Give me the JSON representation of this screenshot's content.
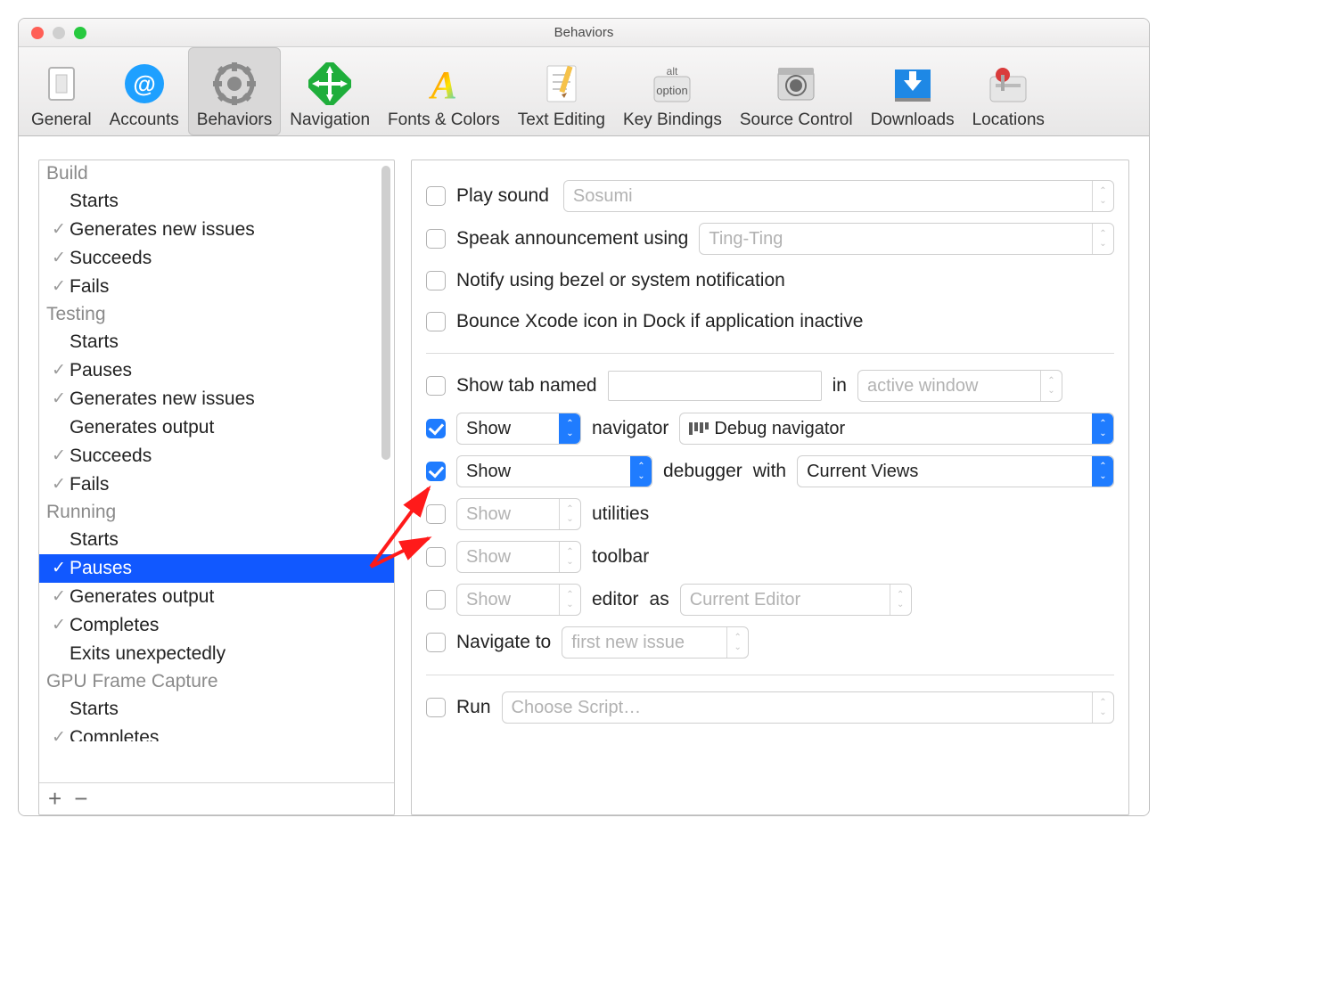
{
  "title": "Behaviors",
  "toolbar": [
    {
      "label": "General",
      "sel": false
    },
    {
      "label": "Accounts",
      "sel": false
    },
    {
      "label": "Behaviors",
      "sel": true
    },
    {
      "label": "Navigation",
      "sel": false
    },
    {
      "label": "Fonts & Colors",
      "sel": false
    },
    {
      "label": "Text Editing",
      "sel": false
    },
    {
      "label": "Key Bindings",
      "sel": false
    },
    {
      "label": "Source Control",
      "sel": false
    },
    {
      "label": "Downloads",
      "sel": false
    },
    {
      "label": "Locations",
      "sel": false
    }
  ],
  "sidebar": {
    "groups": [
      {
        "name": "Build",
        "items": [
          {
            "label": "Starts",
            "chk": false
          },
          {
            "label": "Generates new issues",
            "chk": true
          },
          {
            "label": "Succeeds",
            "chk": true
          },
          {
            "label": "Fails",
            "chk": true
          }
        ]
      },
      {
        "name": "Testing",
        "items": [
          {
            "label": "Starts",
            "chk": false
          },
          {
            "label": "Pauses",
            "chk": true
          },
          {
            "label": "Generates new issues",
            "chk": true
          },
          {
            "label": "Generates output",
            "chk": false
          },
          {
            "label": "Succeeds",
            "chk": true
          },
          {
            "label": "Fails",
            "chk": true
          }
        ]
      },
      {
        "name": "Running",
        "items": [
          {
            "label": "Starts",
            "chk": false
          },
          {
            "label": "Pauses",
            "chk": true,
            "selected": true
          },
          {
            "label": "Generates output",
            "chk": true
          },
          {
            "label": "Completes",
            "chk": true
          },
          {
            "label": "Exits unexpectedly",
            "chk": false
          }
        ]
      },
      {
        "name": "GPU Frame Capture",
        "items": [
          {
            "label": "Starts",
            "chk": false
          },
          {
            "label": "Completes",
            "chk": true,
            "cut": true
          }
        ]
      }
    ]
  },
  "r": {
    "play_sound": {
      "label": "Play sound",
      "value": "Sosumi",
      "on": false
    },
    "speak": {
      "label": "Speak announcement using",
      "value": "Ting-Ting",
      "on": false
    },
    "notify": {
      "label": "Notify using bezel or system notification",
      "on": false
    },
    "bounce": {
      "label": "Bounce Xcode icon in Dock if application inactive",
      "on": false
    },
    "tab": {
      "label": "Show tab named",
      "mid": "in",
      "value": "active window",
      "on": false,
      "input": ""
    },
    "nav": {
      "on": true,
      "action": "Show",
      "mid": "navigator",
      "value": "Debug navigator"
    },
    "dbg": {
      "on": true,
      "action": "Show",
      "mid": "debugger",
      "mid2": "with",
      "value": "Current Views"
    },
    "util": {
      "on": false,
      "action": "Show",
      "mid": "utilities"
    },
    "tool": {
      "on": false,
      "action": "Show",
      "mid": "toolbar"
    },
    "edit": {
      "on": false,
      "action": "Show",
      "mid": "editor",
      "mid2": "as",
      "value": "Current Editor"
    },
    "navto": {
      "on": false,
      "label": "Navigate to",
      "value": "first new issue"
    },
    "run": {
      "on": false,
      "label": "Run",
      "value": "Choose Script…"
    }
  }
}
